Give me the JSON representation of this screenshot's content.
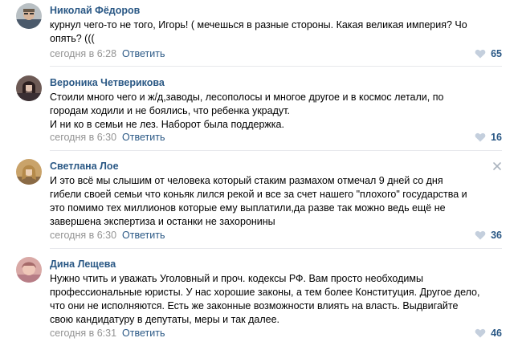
{
  "comments": [
    {
      "author": "Николай Фёдоров",
      "lines": [
        "курнул чего-то не того, Игорь! ( мечешься в разные стороны. Какая великая империя? Чо",
        "опять? ((("
      ],
      "date": "сегодня в 6:28",
      "reply_label": "Ответить",
      "likes": "65",
      "avatar_icon": "person-photo"
    },
    {
      "author": "Вероника Четверикова",
      "lines": [
        "Стоили много чего и ж/д,заводы, лесополосы и многое другое и в космос летали, по",
        "городам ходили и не боялись, что ребенка украдут.",
        "И ни ко в семьи не лез. Наборот была поддержка."
      ],
      "date": "сегодня в 6:30",
      "reply_label": "Ответить",
      "likes": "16",
      "avatar_icon": "person-photo"
    },
    {
      "author": "Светлана Лое",
      "lines": [
        "И это всё мы слышим от человека который стаким размахом отмечал 9 дней со дня",
        "гибели своей семьи что коньяк лился рекой и все за счет нашего \"плохого\" государства и",
        "это помимо тех миллионов которые ему выплатили,да разве так можно ведь ещё не",
        "завершена экспертиза и останки не захоронины"
      ],
      "date": "сегодня в 6:30",
      "reply_label": "Ответить",
      "likes": "36",
      "avatar_icon": "person-photo"
    },
    {
      "author": "Дина Лещева",
      "lines": [
        "Нужно чтить и уважать Уголовный и проч. кодексы РФ. Вам просто необходимы",
        "профессиональные юристы. У нас хорошие законы, а тем более Конституция. Другое дело,",
        "что они не исполняются. Есть же законные возможности влиять на власть. Выдвигайте",
        "свою кандидатуру в депутаты, меры и так далее."
      ],
      "date": "сегодня в 6:31",
      "reply_label": "Ответить",
      "likes": "46",
      "avatar_icon": "person-photo"
    }
  ],
  "colors": {
    "link": "#2a5885",
    "meta": "#939393",
    "divider": "#e7e8ec",
    "heart": "#c4cfdd"
  }
}
